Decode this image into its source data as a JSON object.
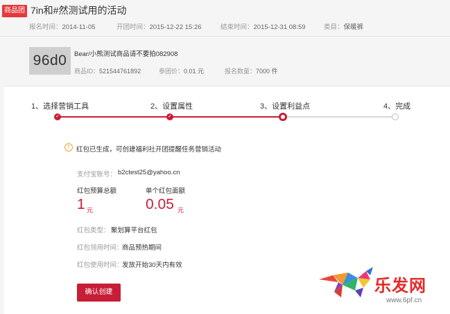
{
  "activity": {
    "tag": "商品团",
    "title": "7in和#然测试用的活动",
    "meta": [
      {
        "key": "报名时间：",
        "value": "2014-11-05"
      },
      {
        "key": "开团时间：",
        "value": "2015-12-22 15:26"
      },
      {
        "key": "结束时间：",
        "value": "2015-12-31 08:59"
      },
      {
        "key": "类目：",
        "value": "保暖裤"
      }
    ]
  },
  "product": {
    "thumb_text": "96d0",
    "name": "Bear/小熊测试商品请不要拍082908",
    "meta": [
      {
        "key": "商品ID：",
        "value": "521544761892"
      },
      {
        "key": "参团价：",
        "value": "0.01 元"
      },
      {
        "key": "报名数量：",
        "value": "7000 件"
      }
    ]
  },
  "steps": [
    {
      "label": "1、选择营销工具",
      "state": "done"
    },
    {
      "label": "2、设置属性",
      "state": "done"
    },
    {
      "label": "3、设置利益点",
      "state": "active"
    },
    {
      "label": "4、完成",
      "state": "todo"
    }
  ],
  "colors": {
    "accent": "#c81d36",
    "warning": "#f2a03c"
  },
  "notice": "红包已生成，可创建福利社开团提醒任务营销活动",
  "form": {
    "alipay_label": "支付宝账号：",
    "alipay_value": "b2ctest25@yahoo.cn",
    "budget_label": "红包预算总额",
    "budget_value": "1",
    "budget_unit": "元",
    "face_label": "单个红包面额",
    "face_value": "0.05",
    "face_unit": "元",
    "type_label": "红包类型：",
    "type_value": "聚划算平台红包",
    "claim_label": "红包领用时间：",
    "claim_value": "商品预热期间",
    "use_label": "红包使用时间：",
    "use_value": "发放开始30天内有效",
    "confirm_label": "确认创建"
  },
  "watermark": {
    "brand": "乐发网",
    "url": "www.6pf.cn"
  },
  "icons": {
    "info": "info-icon",
    "check": "check-icon",
    "logo": "bull-logo-icon"
  }
}
